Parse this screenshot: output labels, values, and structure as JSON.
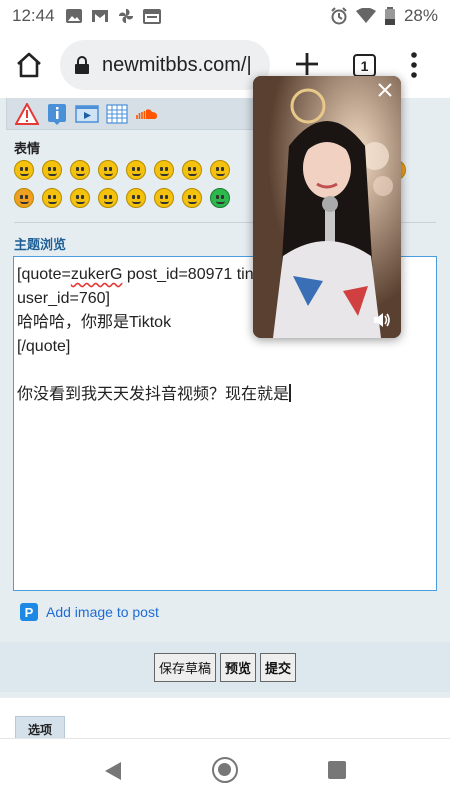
{
  "status_bar": {
    "time": "12:44",
    "battery": "28%",
    "left_icons": [
      "image-icon",
      "gmail-icon",
      "pinwheel-icon",
      "calendar-icon"
    ],
    "right_icons": [
      "alarm-icon",
      "wifi-icon",
      "battery-icon"
    ]
  },
  "browser": {
    "url": "newmitbbs.com/|",
    "tab_count": "1"
  },
  "editor_panel": {
    "smilies_label": "表情",
    "preview_label": "主题浏览",
    "content_lines": [
      "[quote=",
      "zukerG",
      " post_id=80971 tin",
      "user_id=760]",
      "哈哈哈，你那是Tiktok",
      "[/quote]",
      "",
      "你没看到我天天发抖音视频？现在就是"
    ],
    "add_image_label": "Add image to post",
    "add_image_icon": "P"
  },
  "buttons": {
    "save_draft": "保存草稿",
    "preview": "预览",
    "submit": "提交"
  },
  "options": {
    "tab_label": "选项"
  },
  "colors": {
    "page_background": "#e6edf1",
    "link_blue": "#1e6bd6",
    "preview_label": "#1d5f97",
    "editor_border": "#4a9ee0"
  }
}
